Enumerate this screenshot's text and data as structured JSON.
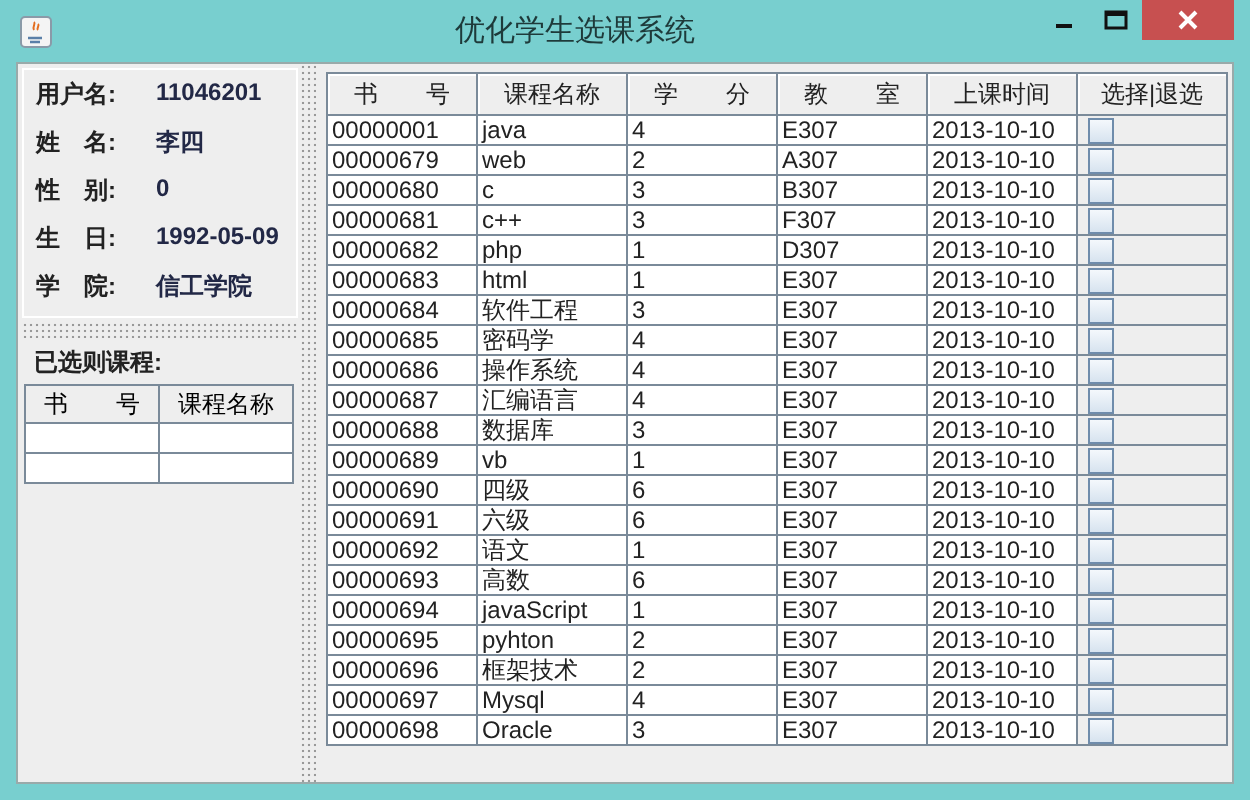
{
  "window": {
    "title": "优化学生选课系统"
  },
  "profile": [
    {
      "label": "用户名:",
      "value": "11046201"
    },
    {
      "label": "姓　名:",
      "value": "李四"
    },
    {
      "label": "性　别:",
      "value": "0"
    },
    {
      "label": "生　日:",
      "value": "1992-05-09"
    },
    {
      "label": "学　院:",
      "value": "信工学院"
    }
  ],
  "selected_courses": {
    "title": "已选则课程:",
    "columns": [
      "书　　号",
      "课程名称"
    ],
    "rows": [
      [
        "",
        ""
      ],
      [
        "",
        ""
      ]
    ]
  },
  "courses": {
    "columns": [
      "书　　号",
      "课程名称",
      "学　　分",
      "教　　室",
      "上课时间",
      "选择|退选"
    ],
    "rows": [
      {
        "cells": [
          "00000001",
          "java",
          "4",
          "E307",
          "2013-10-10"
        ],
        "checked": false
      },
      {
        "cells": [
          "00000679",
          "web",
          "2",
          "A307",
          "2013-10-10"
        ],
        "checked": false
      },
      {
        "cells": [
          "00000680",
          "c",
          "3",
          "B307",
          "2013-10-10"
        ],
        "checked": false
      },
      {
        "cells": [
          "00000681",
          "c++",
          "3",
          "F307",
          "2013-10-10"
        ],
        "checked": false
      },
      {
        "cells": [
          "00000682",
          "php",
          "1",
          "D307",
          "2013-10-10"
        ],
        "checked": false
      },
      {
        "cells": [
          "00000683",
          "html",
          "1",
          "E307",
          "2013-10-10"
        ],
        "checked": false
      },
      {
        "cells": [
          "00000684",
          "软件工程",
          "3",
          "E307",
          "2013-10-10"
        ],
        "checked": false
      },
      {
        "cells": [
          "00000685",
          "密码学",
          "4",
          "E307",
          "2013-10-10"
        ],
        "checked": false
      },
      {
        "cells": [
          "00000686",
          "操作系统",
          "4",
          "E307",
          "2013-10-10"
        ],
        "checked": false
      },
      {
        "cells": [
          "00000687",
          "汇编语言",
          "4",
          "E307",
          "2013-10-10"
        ],
        "checked": false
      },
      {
        "cells": [
          "00000688",
          "数据库",
          "3",
          "E307",
          "2013-10-10"
        ],
        "checked": false
      },
      {
        "cells": [
          "00000689",
          "vb",
          "1",
          "E307",
          "2013-10-10"
        ],
        "checked": false
      },
      {
        "cells": [
          "00000690",
          "四级",
          "6",
          "E307",
          "2013-10-10"
        ],
        "checked": false
      },
      {
        "cells": [
          "00000691",
          "六级",
          "6",
          "E307",
          "2013-10-10"
        ],
        "checked": false
      },
      {
        "cells": [
          "00000692",
          "语文",
          "1",
          "E307",
          "2013-10-10"
        ],
        "checked": false
      },
      {
        "cells": [
          "00000693",
          "高数",
          "6",
          "E307",
          "2013-10-10"
        ],
        "checked": false
      },
      {
        "cells": [
          "00000694",
          "javaScript",
          "1",
          "E307",
          "2013-10-10"
        ],
        "checked": false
      },
      {
        "cells": [
          "00000695",
          "pyhton",
          "2",
          "E307",
          "2013-10-10"
        ],
        "checked": false
      },
      {
        "cells": [
          "00000696",
          "框架技术",
          "2",
          "E307",
          "2013-10-10"
        ],
        "checked": false
      },
      {
        "cells": [
          "00000697",
          "Mysql",
          "4",
          "E307",
          "2013-10-10"
        ],
        "checked": false
      },
      {
        "cells": [
          "00000698",
          "Oracle",
          "3",
          "E307",
          "2013-10-10"
        ],
        "checked": false
      }
    ]
  }
}
